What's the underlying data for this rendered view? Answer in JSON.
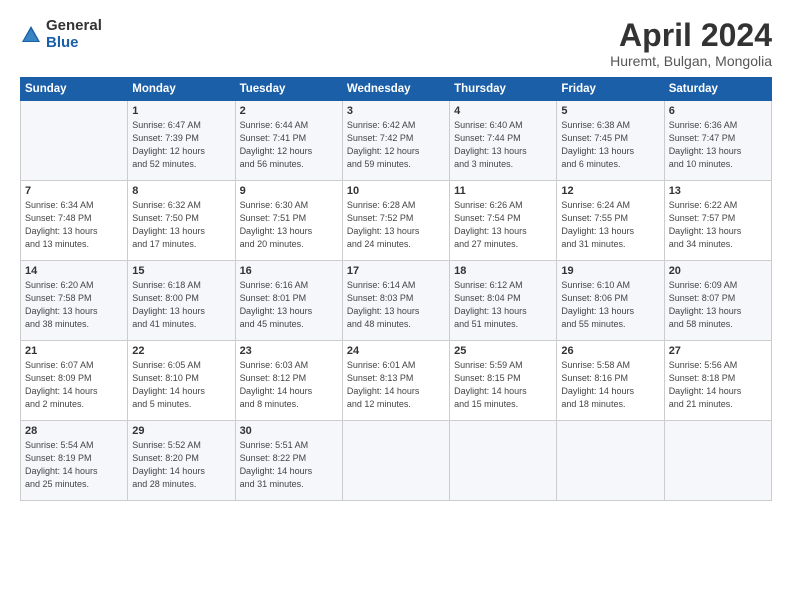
{
  "logo": {
    "general": "General",
    "blue": "Blue"
  },
  "title": "April 2024",
  "location": "Huremt, Bulgan, Mongolia",
  "days_of_week": [
    "Sunday",
    "Monday",
    "Tuesday",
    "Wednesday",
    "Thursday",
    "Friday",
    "Saturday"
  ],
  "weeks": [
    [
      {
        "day": "",
        "info": ""
      },
      {
        "day": "1",
        "info": "Sunrise: 6:47 AM\nSunset: 7:39 PM\nDaylight: 12 hours\nand 52 minutes."
      },
      {
        "day": "2",
        "info": "Sunrise: 6:44 AM\nSunset: 7:41 PM\nDaylight: 12 hours\nand 56 minutes."
      },
      {
        "day": "3",
        "info": "Sunrise: 6:42 AM\nSunset: 7:42 PM\nDaylight: 12 hours\nand 59 minutes."
      },
      {
        "day": "4",
        "info": "Sunrise: 6:40 AM\nSunset: 7:44 PM\nDaylight: 13 hours\nand 3 minutes."
      },
      {
        "day": "5",
        "info": "Sunrise: 6:38 AM\nSunset: 7:45 PM\nDaylight: 13 hours\nand 6 minutes."
      },
      {
        "day": "6",
        "info": "Sunrise: 6:36 AM\nSunset: 7:47 PM\nDaylight: 13 hours\nand 10 minutes."
      }
    ],
    [
      {
        "day": "7",
        "info": "Sunrise: 6:34 AM\nSunset: 7:48 PM\nDaylight: 13 hours\nand 13 minutes."
      },
      {
        "day": "8",
        "info": "Sunrise: 6:32 AM\nSunset: 7:50 PM\nDaylight: 13 hours\nand 17 minutes."
      },
      {
        "day": "9",
        "info": "Sunrise: 6:30 AM\nSunset: 7:51 PM\nDaylight: 13 hours\nand 20 minutes."
      },
      {
        "day": "10",
        "info": "Sunrise: 6:28 AM\nSunset: 7:52 PM\nDaylight: 13 hours\nand 24 minutes."
      },
      {
        "day": "11",
        "info": "Sunrise: 6:26 AM\nSunset: 7:54 PM\nDaylight: 13 hours\nand 27 minutes."
      },
      {
        "day": "12",
        "info": "Sunrise: 6:24 AM\nSunset: 7:55 PM\nDaylight: 13 hours\nand 31 minutes."
      },
      {
        "day": "13",
        "info": "Sunrise: 6:22 AM\nSunset: 7:57 PM\nDaylight: 13 hours\nand 34 minutes."
      }
    ],
    [
      {
        "day": "14",
        "info": "Sunrise: 6:20 AM\nSunset: 7:58 PM\nDaylight: 13 hours\nand 38 minutes."
      },
      {
        "day": "15",
        "info": "Sunrise: 6:18 AM\nSunset: 8:00 PM\nDaylight: 13 hours\nand 41 minutes."
      },
      {
        "day": "16",
        "info": "Sunrise: 6:16 AM\nSunset: 8:01 PM\nDaylight: 13 hours\nand 45 minutes."
      },
      {
        "day": "17",
        "info": "Sunrise: 6:14 AM\nSunset: 8:03 PM\nDaylight: 13 hours\nand 48 minutes."
      },
      {
        "day": "18",
        "info": "Sunrise: 6:12 AM\nSunset: 8:04 PM\nDaylight: 13 hours\nand 51 minutes."
      },
      {
        "day": "19",
        "info": "Sunrise: 6:10 AM\nSunset: 8:06 PM\nDaylight: 13 hours\nand 55 minutes."
      },
      {
        "day": "20",
        "info": "Sunrise: 6:09 AM\nSunset: 8:07 PM\nDaylight: 13 hours\nand 58 minutes."
      }
    ],
    [
      {
        "day": "21",
        "info": "Sunrise: 6:07 AM\nSunset: 8:09 PM\nDaylight: 14 hours\nand 2 minutes."
      },
      {
        "day": "22",
        "info": "Sunrise: 6:05 AM\nSunset: 8:10 PM\nDaylight: 14 hours\nand 5 minutes."
      },
      {
        "day": "23",
        "info": "Sunrise: 6:03 AM\nSunset: 8:12 PM\nDaylight: 14 hours\nand 8 minutes."
      },
      {
        "day": "24",
        "info": "Sunrise: 6:01 AM\nSunset: 8:13 PM\nDaylight: 14 hours\nand 12 minutes."
      },
      {
        "day": "25",
        "info": "Sunrise: 5:59 AM\nSunset: 8:15 PM\nDaylight: 14 hours\nand 15 minutes."
      },
      {
        "day": "26",
        "info": "Sunrise: 5:58 AM\nSunset: 8:16 PM\nDaylight: 14 hours\nand 18 minutes."
      },
      {
        "day": "27",
        "info": "Sunrise: 5:56 AM\nSunset: 8:18 PM\nDaylight: 14 hours\nand 21 minutes."
      }
    ],
    [
      {
        "day": "28",
        "info": "Sunrise: 5:54 AM\nSunset: 8:19 PM\nDaylight: 14 hours\nand 25 minutes."
      },
      {
        "day": "29",
        "info": "Sunrise: 5:52 AM\nSunset: 8:20 PM\nDaylight: 14 hours\nand 28 minutes."
      },
      {
        "day": "30",
        "info": "Sunrise: 5:51 AM\nSunset: 8:22 PM\nDaylight: 14 hours\nand 31 minutes."
      },
      {
        "day": "",
        "info": ""
      },
      {
        "day": "",
        "info": ""
      },
      {
        "day": "",
        "info": ""
      },
      {
        "day": "",
        "info": ""
      }
    ]
  ]
}
